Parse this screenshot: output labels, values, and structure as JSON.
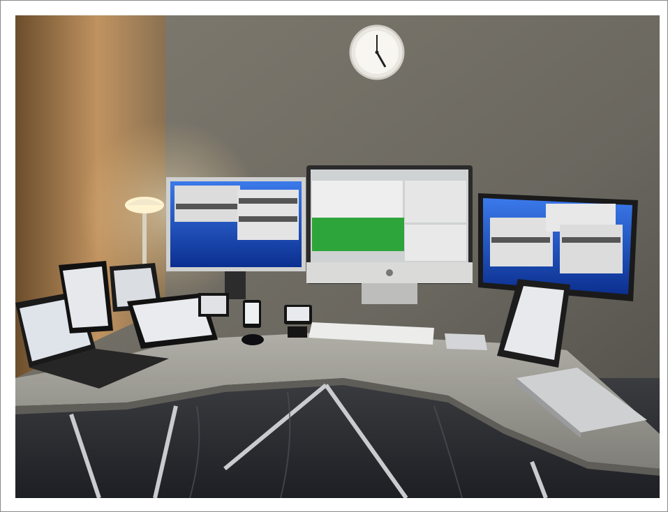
{
  "scene": {
    "subject": "desk-with-multiple-monitors",
    "colors": {
      "wall_left": "#b98a55",
      "wall_back": "#6f6a60",
      "desk": "#9b9a93",
      "floor": "#2a2c31",
      "screen_blue": "#1f55c9",
      "screen_green": "#2ea53a"
    }
  }
}
